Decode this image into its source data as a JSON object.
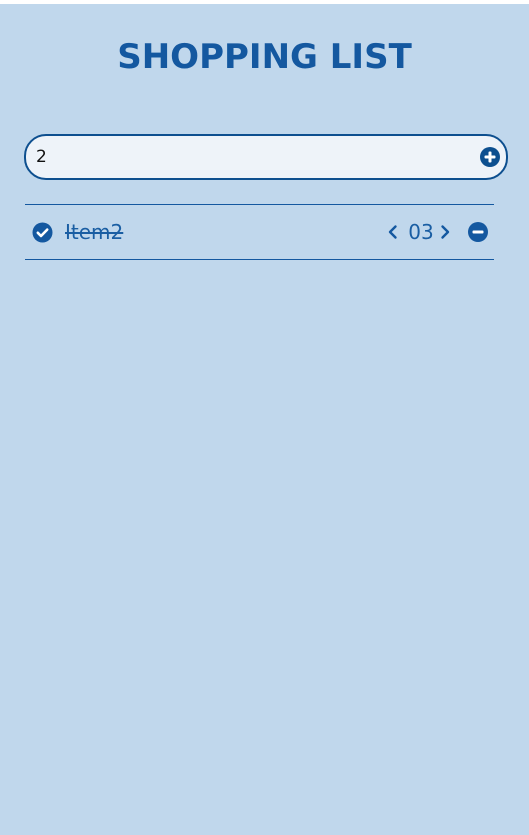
{
  "app": {
    "title": "SHOPPING LIST"
  },
  "input": {
    "value": "2",
    "placeholder": ""
  },
  "items": [
    {
      "name": "Item2",
      "quantity": "03",
      "completed": true
    }
  ],
  "icons": {
    "add": "plus-circle-icon",
    "check": "check-circle-icon",
    "decrement": "chevron-left-icon",
    "increment": "chevron-right-icon",
    "remove": "minus-circle-icon"
  },
  "colors": {
    "background": "#c0d7ec",
    "accent": "#1458a0",
    "input_bg": "#eef3f9"
  }
}
